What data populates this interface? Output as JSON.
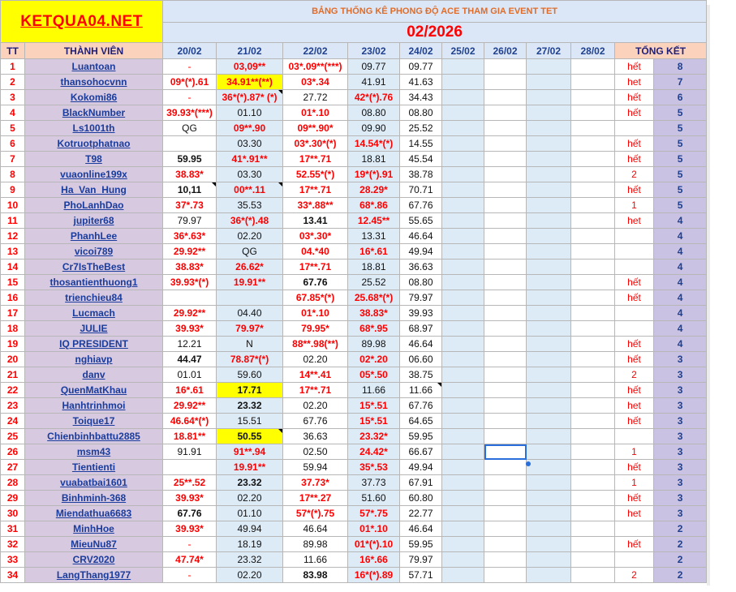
{
  "logo": "KETQUA04.NET",
  "title": "BẢNG THỐNG KÊ PHONG ĐỘ ACE THAM GIA EVENT TET",
  "month": "02/2026",
  "headers": {
    "tt": "TT",
    "member": "THÀNH VIÊN",
    "dates": [
      "20/02",
      "21/02",
      "22/02",
      "23/02",
      "24/02",
      "25/02",
      "26/02",
      "27/02",
      "28/02"
    ],
    "total": "TỔNG KẾT"
  },
  "rows": [
    {
      "tt": "1",
      "name": "Luantoan",
      "d": [
        "-",
        "03,09**",
        "03*.09**(***)",
        "09.77",
        "09.77",
        "",
        "",
        "",
        ""
      ],
      "note": "hết",
      "total": "8"
    },
    {
      "tt": "2",
      "name": "thansohocvnn",
      "d": [
        "09*(*).61",
        "34.91**(**)",
        "03*.34",
        "41.91",
        "41.63",
        "",
        "",
        "",
        ""
      ],
      "note": "het",
      "total": "7"
    },
    {
      "tt": "3",
      "name": "Kokomi86",
      "d": [
        "-",
        "36*(*).87* (*)",
        "27.72",
        "42*(*).76",
        "34.43",
        "",
        "",
        "",
        ""
      ],
      "note": "hết",
      "total": "6"
    },
    {
      "tt": "4",
      "name": "BlackNumber",
      "d": [
        "39.93*(***)",
        "01.10",
        "01*.10",
        "08.80",
        "08.80",
        "",
        "",
        "",
        ""
      ],
      "note": "hết",
      "total": "5"
    },
    {
      "tt": "5",
      "name": "Ls1001th",
      "d": [
        "QG",
        "09**.90",
        "09**.90*",
        "09.90",
        "25.52",
        "",
        "",
        "",
        ""
      ],
      "note": "",
      "total": "5"
    },
    {
      "tt": "6",
      "name": "Kotruotphatnao",
      "d": [
        "",
        "03.30",
        "03*.30*(*)",
        "14.54*(*)",
        "14.55",
        "",
        "",
        "",
        ""
      ],
      "note": "hết",
      "total": "5"
    },
    {
      "tt": "7",
      "name": "T98",
      "d": [
        "59.95",
        "41*.91**",
        "17**.71",
        "18.81",
        "45.54",
        "",
        "",
        "",
        ""
      ],
      "note": "hết",
      "total": "5"
    },
    {
      "tt": "8",
      "name": "vuaonline199x",
      "d": [
        "38.83*",
        "03.30",
        "52.55*(*)",
        "19*(*).91",
        "38.78",
        "",
        "",
        "",
        ""
      ],
      "note": "2",
      "total": "5"
    },
    {
      "tt": "9",
      "name": "Ha_Van_Hung",
      "d": [
        "10,11",
        "00**.11",
        "17**.71",
        "28.29*",
        "70.71",
        "",
        "",
        "",
        ""
      ],
      "note": "hết",
      "total": "5"
    },
    {
      "tt": "10",
      "name": "PhoLanhDao",
      "d": [
        "37*.73",
        "35.53",
        "33*.88**",
        "68*.86",
        "67.76",
        "",
        "",
        "",
        ""
      ],
      "note": "1",
      "total": "5"
    },
    {
      "tt": "11",
      "name": "jupiter68",
      "d": [
        "79.97",
        "36*(*).48",
        "13.41",
        "12.45**",
        "55.65",
        "",
        "",
        "",
        ""
      ],
      "note": "het",
      "total": "4"
    },
    {
      "tt": "12",
      "name": "PhanhLee",
      "d": [
        "36*.63*",
        "02.20",
        "03*.30*",
        "13.31",
        "46.64",
        "",
        "",
        "",
        ""
      ],
      "note": "",
      "total": "4"
    },
    {
      "tt": "13",
      "name": "vicoi789",
      "d": [
        "29.92**",
        "QG",
        "04.*40",
        "16*.61",
        "49.94",
        "",
        "",
        "",
        ""
      ],
      "note": "",
      "total": "4"
    },
    {
      "tt": "14",
      "name": "Cr7IsTheBest",
      "d": [
        "38.83*",
        "26.62*",
        "17**.71",
        "18.81",
        "36.63",
        "",
        "",
        "",
        ""
      ],
      "note": "",
      "total": "4"
    },
    {
      "tt": "15",
      "name": "thosantienthuong1",
      "d": [
        "39.93*(*)",
        "19.91**",
        "67.76",
        "25.52",
        "08.80",
        "",
        "",
        "",
        ""
      ],
      "note": "hết",
      "total": "4"
    },
    {
      "tt": "16",
      "name": "trienchieu84",
      "d": [
        "",
        "",
        "67.85*(*)",
        "25.68*(*)",
        "79.97",
        "",
        "",
        "",
        ""
      ],
      "note": "hết",
      "total": "4"
    },
    {
      "tt": "17",
      "name": "Lucmach",
      "d": [
        "29.92**",
        "04.40",
        "01*.10",
        "38.83*",
        "39.93",
        "",
        "",
        "",
        ""
      ],
      "note": "",
      "total": "4"
    },
    {
      "tt": "18",
      "name": "JULIE",
      "d": [
        "39.93*",
        "79.97*",
        "79.95*",
        "68*.95",
        "68.97",
        "",
        "",
        "",
        ""
      ],
      "note": "",
      "total": "4"
    },
    {
      "tt": "19",
      "name": "IQ PRESIDENT",
      "d": [
        "12.21",
        "N",
        "88**.98(**)",
        "89.98",
        "46.64",
        "",
        "",
        "",
        ""
      ],
      "note": "hết",
      "total": "4"
    },
    {
      "tt": "20",
      "name": "nghiavp",
      "d": [
        "44.47",
        "78.87*(*)",
        "02.20",
        "02*.20",
        "06.60",
        "",
        "",
        "",
        ""
      ],
      "note": "hết",
      "total": "3"
    },
    {
      "tt": "21",
      "name": "danv",
      "d": [
        "01.01",
        "59.60",
        "14**.41",
        "05*.50",
        "38.75",
        "",
        "",
        "",
        ""
      ],
      "note": "2",
      "total": "3"
    },
    {
      "tt": "22",
      "name": "QuenMatKhau",
      "d": [
        "16*.61",
        "17.71",
        "17**.71",
        "11.66",
        "11.66",
        "",
        "",
        "",
        ""
      ],
      "note": "hết",
      "total": "3"
    },
    {
      "tt": "23",
      "name": "Hanhtrinhmoi",
      "d": [
        "29.92**",
        "23.32",
        "02.20",
        "15*.51",
        "67.76",
        "",
        "",
        "",
        ""
      ],
      "note": "het",
      "total": "3"
    },
    {
      "tt": "24",
      "name": "Toique17",
      "d": [
        "46.64*(*)",
        "15.51",
        "67.76",
        "15*.51",
        "64.65",
        "",
        "",
        "",
        ""
      ],
      "note": "hết",
      "total": "3"
    },
    {
      "tt": "25",
      "name": "Chienbinhbattu2885",
      "d": [
        "18.81**",
        "50.55",
        "36.63",
        "23.32*",
        "59.95",
        "",
        "",
        "",
        ""
      ],
      "note": "",
      "total": "3"
    },
    {
      "tt": "26",
      "name": "msm43",
      "d": [
        "91.91",
        "91**.94",
        "02.50",
        "24.42*",
        "66.67",
        "",
        "",
        "",
        ""
      ],
      "note": "1",
      "total": "3"
    },
    {
      "tt": "27",
      "name": "Tientienti",
      "d": [
        "",
        "19.91**",
        "59.94",
        "35*.53",
        "49.94",
        "",
        "",
        "",
        ""
      ],
      "note": "hết",
      "total": "3"
    },
    {
      "tt": "28",
      "name": "vuabatbai1601",
      "d": [
        "25**.52",
        "23.32",
        "37.73*",
        "37.73",
        "67.91",
        "",
        "",
        "",
        ""
      ],
      "note": "1",
      "total": "3"
    },
    {
      "tt": "29",
      "name": "Binhminh-368",
      "d": [
        "39.93*",
        "02.20",
        "17**.27",
        "51.60",
        "60.80",
        "",
        "",
        "",
        ""
      ],
      "note": "hết",
      "total": "3"
    },
    {
      "tt": "30",
      "name": "Miendathua6683",
      "d": [
        "67.76",
        "01.10",
        "57*(*).75",
        "57*.75",
        "22.77",
        "",
        "",
        "",
        ""
      ],
      "note": "het",
      "total": "3"
    },
    {
      "tt": "31",
      "name": "MinhHoe",
      "d": [
        "39.93*",
        "49.94",
        "46.64",
        "01*.10",
        "46.64",
        "",
        "",
        "",
        ""
      ],
      "note": "",
      "total": "2"
    },
    {
      "tt": "32",
      "name": "MieuNu87",
      "d": [
        "-",
        "18.19",
        "89.98",
        "01*(*).10",
        "59.95",
        "",
        "",
        "",
        ""
      ],
      "note": "hết",
      "total": "2"
    },
    {
      "tt": "33",
      "name": "CRV2020",
      "d": [
        "47.74*",
        "23.32",
        "11.66",
        "16*.66",
        "79.97",
        "",
        "",
        "",
        ""
      ],
      "note": "",
      "total": "2"
    },
    {
      "tt": "34",
      "name": "LangThang1977",
      "d": [
        "-",
        "02.20",
        "83.98",
        "16*(*).89",
        "57.71",
        "",
        "",
        "",
        ""
      ],
      "note": "2",
      "total": "2"
    }
  ]
}
